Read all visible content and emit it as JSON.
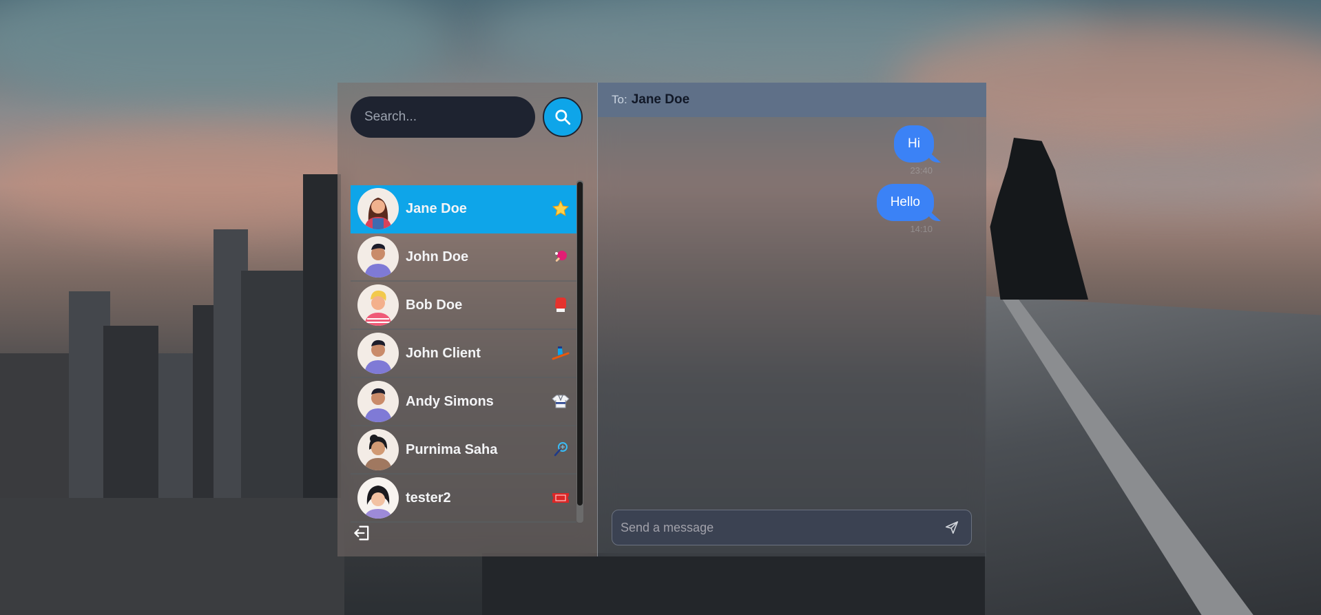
{
  "search": {
    "placeholder": "Search..."
  },
  "contacts": [
    {
      "name": "Jane Doe",
      "icon": "star-icon",
      "active": true
    },
    {
      "name": "John Doe",
      "icon": "ping-pong-icon",
      "active": false
    },
    {
      "name": "Bob Doe",
      "icon": "boxing-glove-icon",
      "active": false
    },
    {
      "name": "John Client",
      "icon": "ski-icon",
      "active": false
    },
    {
      "name": "Andy Simons",
      "icon": "martial-arts-uniform-icon",
      "active": false
    },
    {
      "name": "Purnima Saha",
      "icon": "badminton-icon",
      "active": false
    },
    {
      "name": "tester2",
      "icon": "ticket-icon",
      "active": false
    }
  ],
  "chat": {
    "to_label": "To:",
    "to_name": "Jane Doe",
    "messages": [
      {
        "text": "Hi",
        "time": "23:40"
      },
      {
        "text": "Hello",
        "time": "14:10"
      }
    ],
    "composer_placeholder": "Send a message"
  },
  "colors": {
    "accent": "#0ea5e9",
    "bubble": "#3b82f6",
    "header": "#5f7088"
  }
}
